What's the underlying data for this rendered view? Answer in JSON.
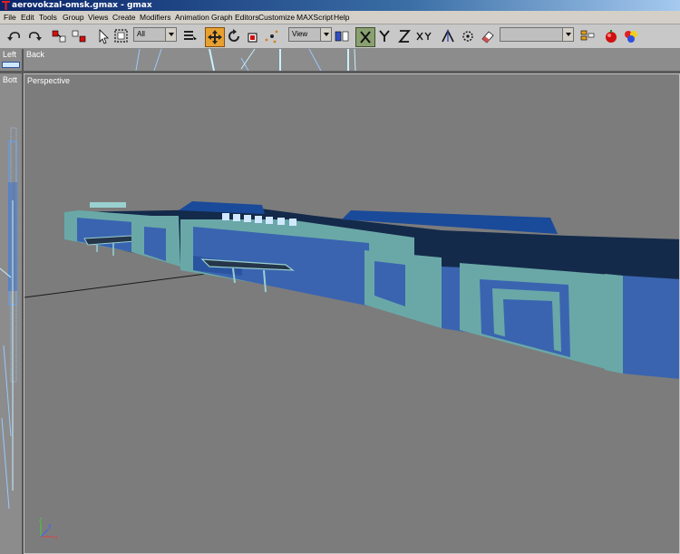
{
  "window": {
    "title": "aerovokzal-omsk.gmax - gmax"
  },
  "menu": {
    "items": [
      "File",
      "Edit",
      "Tools",
      "Group",
      "Views",
      "Create",
      "Modifiers",
      "Animation",
      "Graph Editors",
      "Customize",
      "MAXScript",
      "Help"
    ]
  },
  "toolbar": {
    "selection_filter": "All",
    "reference_coord": "View",
    "named_selection": "",
    "icons": [
      "undo-icon",
      "redo-icon",
      "link-icon",
      "unlink-icon",
      "select-arrow-icon",
      "region-select-icon",
      "select-by-name-icon",
      "move-icon",
      "rotate-icon",
      "scale-icon",
      "pivot-icon",
      "mirror-icon",
      "restrict-x-icon",
      "restrict-y-icon",
      "restrict-z-icon",
      "restrict-xy-icon",
      "snap-icon",
      "spinner-snap-icon",
      "eraser-icon",
      "layer-icon",
      "render-icon",
      "material-editor-icon"
    ]
  },
  "viewports": {
    "left": "Left",
    "back": "Back",
    "bottom": "Bott",
    "perspective": "Perspective"
  },
  "colors": {
    "building_blue": "#3a64b0",
    "building_teal": "#6aa8a8",
    "roof_dark": "#142a4a",
    "viewport_bg": "#7c7c7c"
  }
}
